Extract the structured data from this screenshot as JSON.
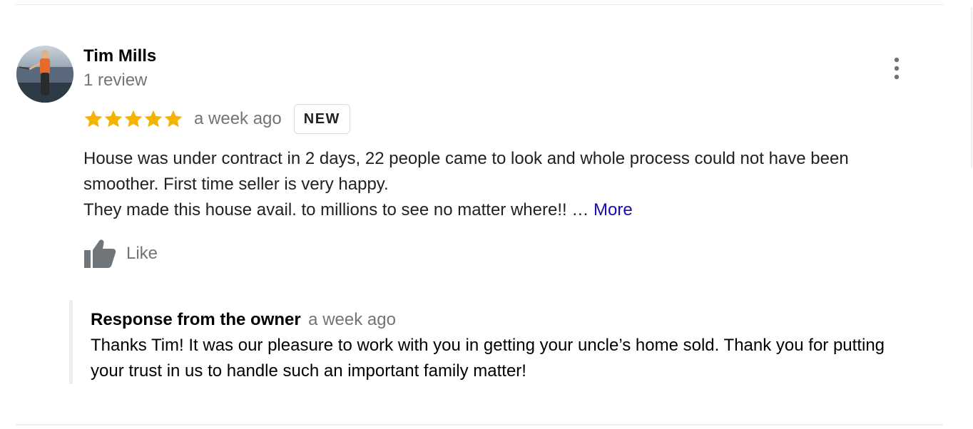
{
  "review": {
    "reviewer_name": "Tim Mills",
    "review_count": "1 review",
    "rating": 5,
    "max_rating": 5,
    "star_color": "#f4b400",
    "time": "a week ago",
    "badge": "NEW",
    "text_lines": [
      "House was under contract in 2 days, 22 people came to look and whole process could not have been",
      "smoother. First time seller is very happy.",
      "They made this house avail. to millions to see no matter where!! … "
    ],
    "more_label": "More",
    "like_label": "Like",
    "more_options_icon": "more-vert-icon"
  },
  "owner_response": {
    "title": "Response from the owner",
    "time": "a week ago",
    "text": "Thanks Tim! It was our pleasure to work with you in getting your uncle’s home sold. Thank you for putting your trust in us to handle such an important family matter!"
  },
  "colors": {
    "link": "#1a0dab",
    "secondary_text": "#70757a",
    "primary_text": "#202124"
  }
}
